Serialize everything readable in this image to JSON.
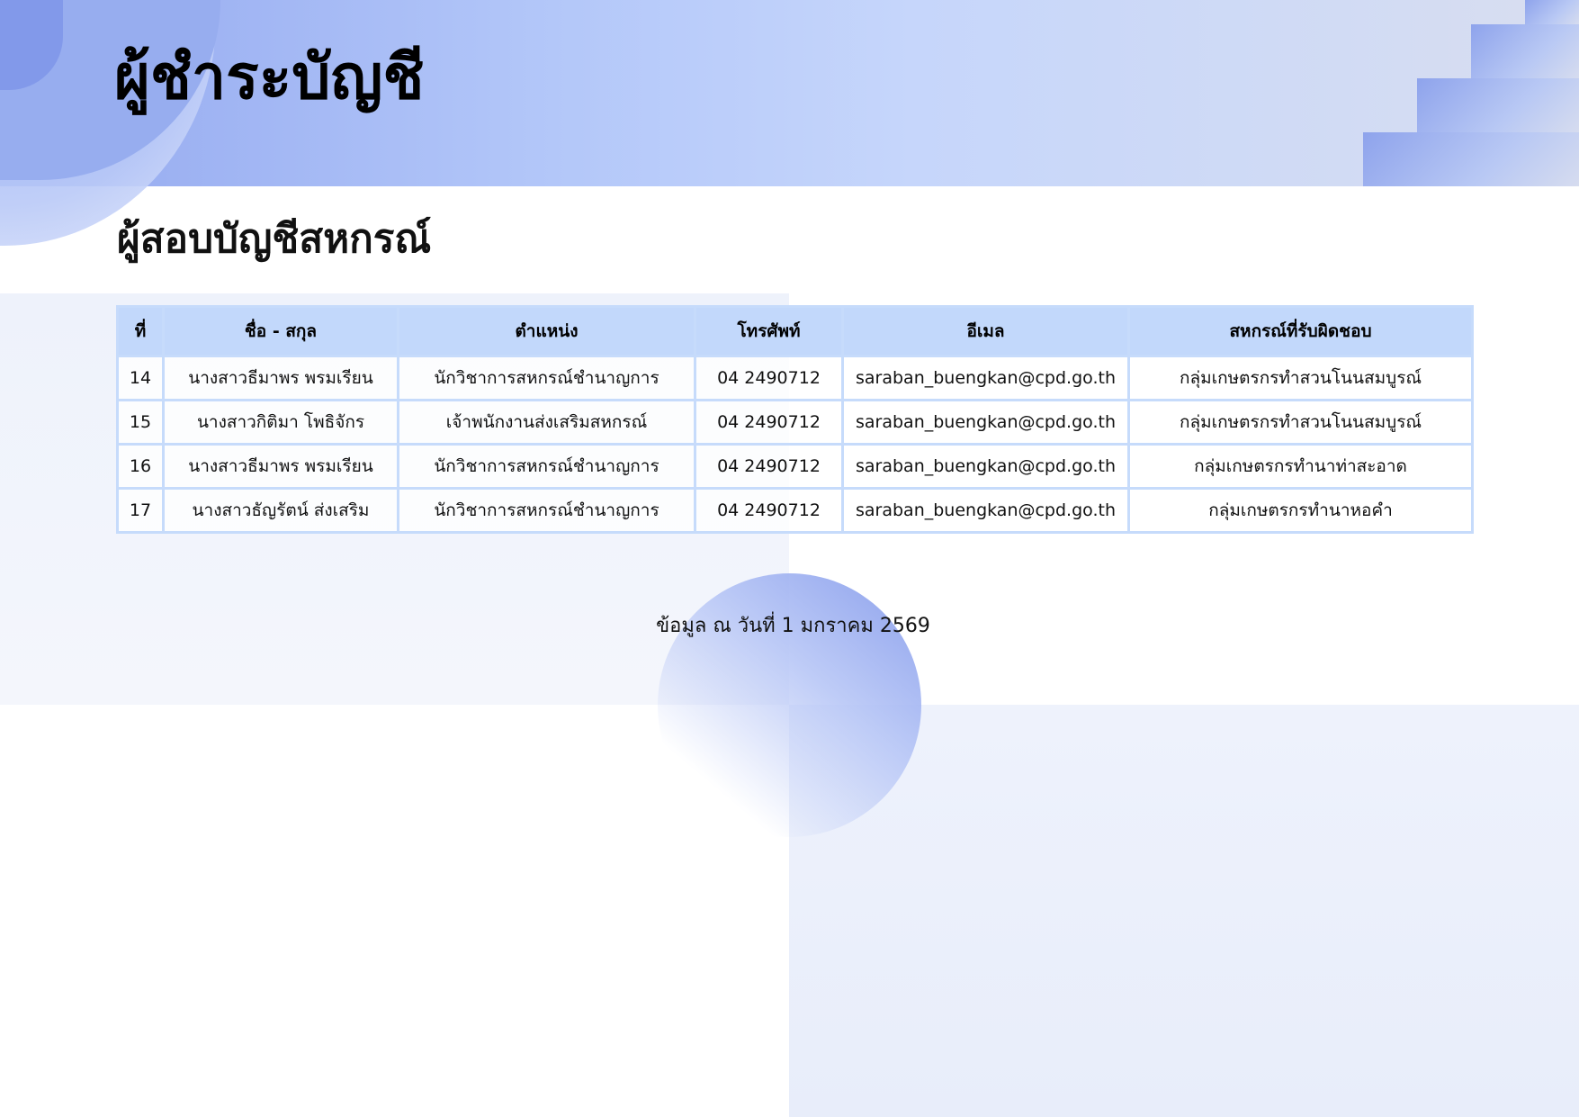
{
  "page": {
    "title": "ผู้ชำระบัญชี",
    "subtitle": "ผู้สอบบัญชีสหกรณ์",
    "footer_note": "ข้อมูล ณ วันที่ 1 มกราคม 2569"
  },
  "table": {
    "headers": {
      "no": "ที่",
      "name": "ชื่อ - สกุล",
      "position": "ตำแหน่ง",
      "phone": "โทรศัพท์",
      "email": "อีเมล",
      "cooperative": "สหกรณ์ที่รับผิดชอบ"
    },
    "rows": [
      {
        "no": "14",
        "name": "นางสาวธีมาพร  พรมเรียน",
        "position": "นักวิชาการสหกรณ์ชำนาญการ",
        "phone": "04 2490712",
        "email": "saraban_buengkan@cpd.go.th",
        "cooperative": "กลุ่มเกษตรกรทำสวนโนนสมบูรณ์"
      },
      {
        "no": "15",
        "name": "นางสาวกิติมา  โพธิจักร",
        "position": "เจ้าพนักงานส่งเสริมสหกรณ์",
        "phone": "04 2490712",
        "email": "saraban_buengkan@cpd.go.th",
        "cooperative": "กลุ่มเกษตรกรทำสวนโนนสมบูรณ์"
      },
      {
        "no": "16",
        "name": "นางสาวธีมาพร  พรมเรียน",
        "position": "นักวิชาการสหกรณ์ชำนาญการ",
        "phone": "04 2490712",
        "email": "saraban_buengkan@cpd.go.th",
        "cooperative": "กลุ่มเกษตรกรทำนาท่าสะอาด"
      },
      {
        "no": "17",
        "name": "นางสาวธัญรัตน์  ส่งเสริม",
        "position": "นักวิชาการสหกรณ์ชำนาญการ",
        "phone": "04 2490712",
        "email": "saraban_buengkan@cpd.go.th",
        "cooperative": "กลุ่มเกษตรกรทำนาหอคำ"
      }
    ]
  },
  "colors": {
    "header_band": "#b3c7f9",
    "table_header_bg": "#c2d8fb",
    "table_border": "#c6dbfb",
    "accent_blue": "#8299ea"
  }
}
